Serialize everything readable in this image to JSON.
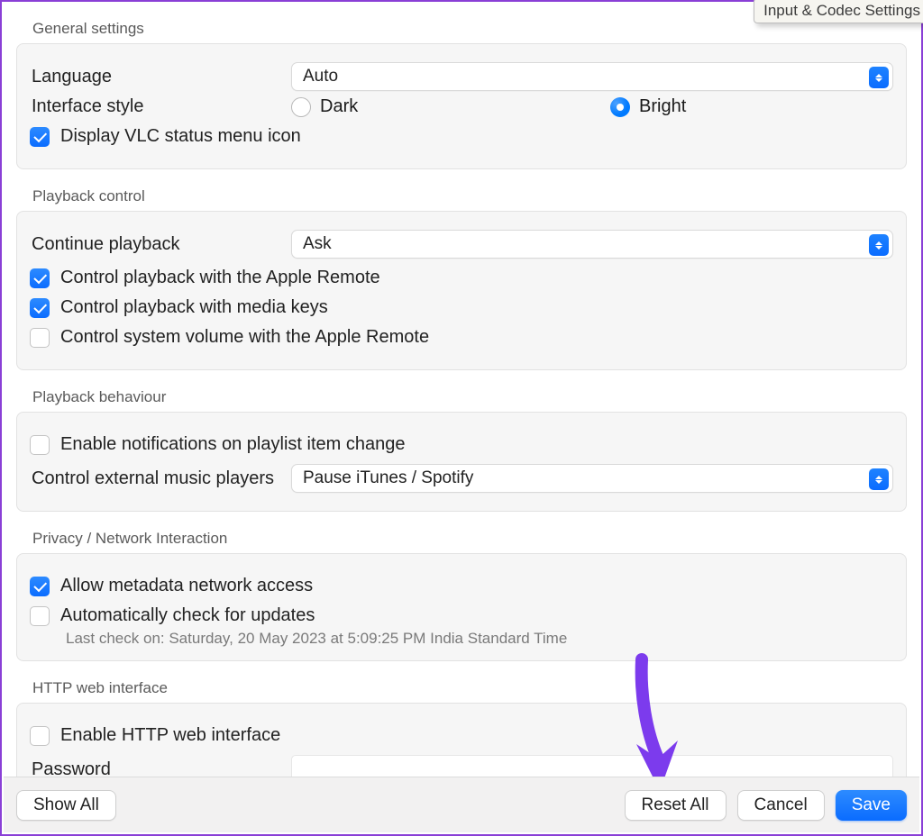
{
  "tooltip": "Input & Codec Settings",
  "sections": {
    "general": {
      "title": "General settings",
      "language_label": "Language",
      "language_value": "Auto",
      "interface_style_label": "Interface style",
      "style_dark": "Dark",
      "style_bright": "Bright",
      "status_menu": "Display VLC status menu icon"
    },
    "playback_control": {
      "title": "Playback control",
      "continue_label": "Continue playback",
      "continue_value": "Ask",
      "apple_remote": "Control playback with the Apple Remote",
      "media_keys": "Control playback with media keys",
      "system_volume_remote": "Control system volume with the Apple Remote"
    },
    "playback_behaviour": {
      "title": "Playback behaviour",
      "notifications": "Enable notifications on playlist item change",
      "external_label": "Control external music players",
      "external_value": "Pause iTunes / Spotify"
    },
    "privacy": {
      "title": "Privacy / Network Interaction",
      "metadata": "Allow metadata network access",
      "updates": "Automatically check for updates",
      "last_check": "Last check on: Saturday, 20 May 2023 at 5:09:25 PM India Standard Time"
    },
    "http": {
      "title": "HTTP web interface",
      "enable": "Enable HTTP web interface",
      "password_label": "Password"
    }
  },
  "toolbar": {
    "show_all": "Show All",
    "reset_all": "Reset All",
    "cancel": "Cancel",
    "save": "Save"
  }
}
